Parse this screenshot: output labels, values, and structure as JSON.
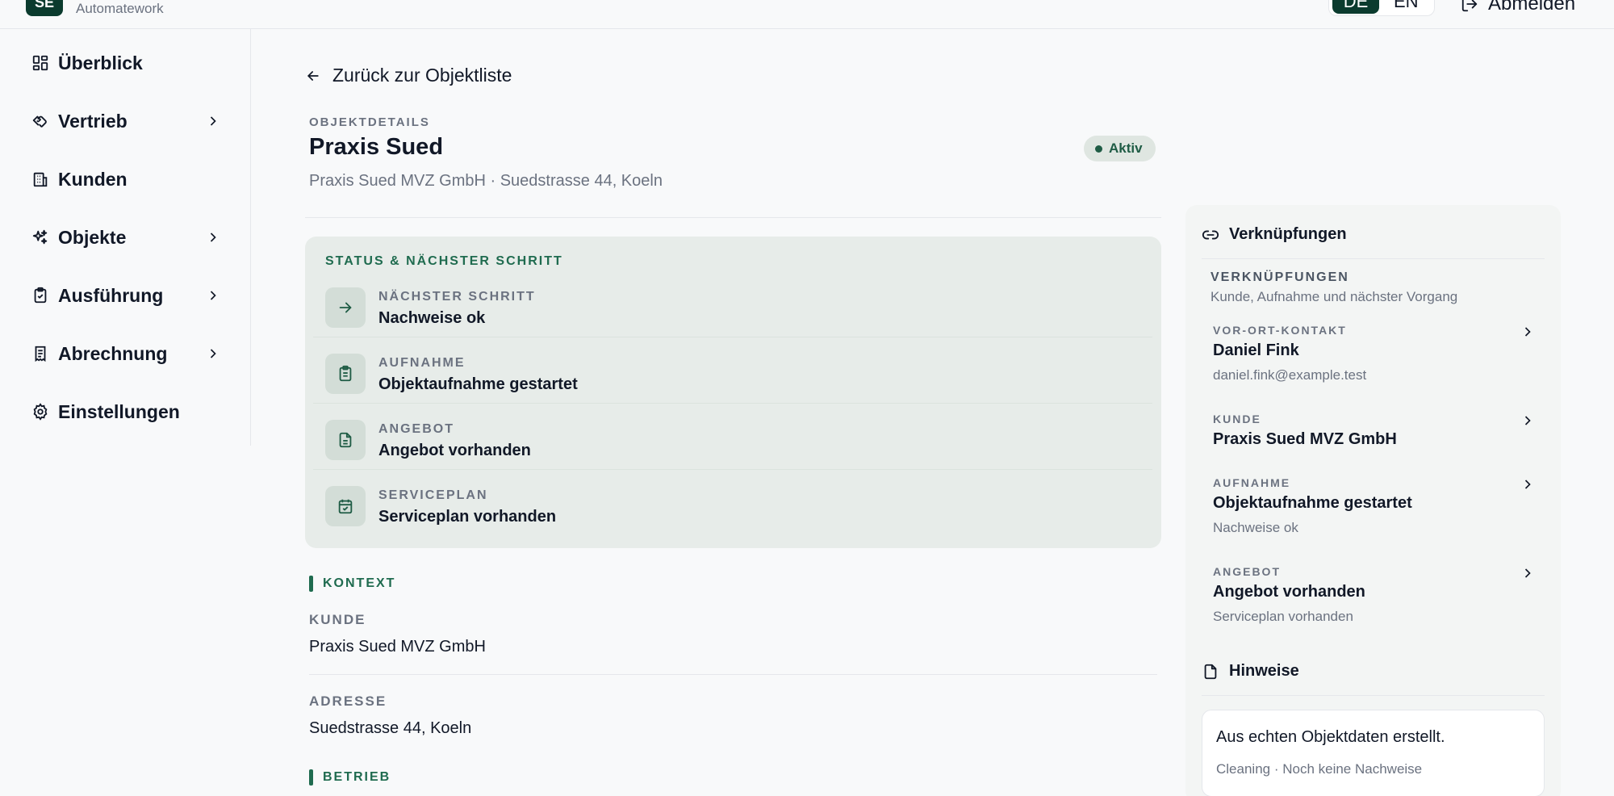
{
  "brand": {
    "logo_text": "SE",
    "subtitle": "Automatework"
  },
  "header": {
    "lang_de": "DE",
    "lang_en": "EN",
    "logout": "Abmelden"
  },
  "sidebar": {
    "items": [
      {
        "label": "Überblick",
        "icon": "dashboard-icon",
        "has_children": false
      },
      {
        "label": "Vertrieb",
        "icon": "handshake-icon",
        "has_children": true
      },
      {
        "label": "Kunden",
        "icon": "building-icon",
        "has_children": false
      },
      {
        "label": "Objekte",
        "icon": "sparkles-icon",
        "has_children": true
      },
      {
        "label": "Ausführung",
        "icon": "clipboard-check-icon",
        "has_children": true
      },
      {
        "label": "Abrechnung",
        "icon": "receipt-icon",
        "has_children": true
      },
      {
        "label": "Einstellungen",
        "icon": "gear-icon",
        "has_children": false
      }
    ]
  },
  "main": {
    "back_link": "Zurück zur Objektliste",
    "eyebrow": "OBJEKTDETAILS",
    "title": "Praxis Sued",
    "subtitle": "Praxis Sued MVZ GmbH · Suedstrasse 44, Koeln",
    "status": "Aktiv",
    "status_panel": {
      "eyebrow": "STATUS & NÄCHSTER SCHRITT",
      "steps": [
        {
          "label": "NÄCHSTER SCHRITT",
          "value": "Nachweise ok",
          "icon": "arrow-right-icon"
        },
        {
          "label": "AUFNAHME",
          "value": "Objektaufnahme gestartet",
          "icon": "clipboard-list-icon"
        },
        {
          "label": "ANGEBOT",
          "value": "Angebot vorhanden",
          "icon": "document-icon"
        },
        {
          "label": "SERVICEPLAN",
          "value": "Serviceplan vorhanden",
          "icon": "calendar-check-icon"
        }
      ]
    },
    "context": {
      "heading": "KONTEXT",
      "fields": [
        {
          "label": "KUNDE",
          "value": "Praxis Sued MVZ GmbH"
        },
        {
          "label": "ADRESSE",
          "value": "Suedstrasse 44, Koeln"
        }
      ]
    },
    "operation": {
      "heading": "BETRIEB"
    }
  },
  "right_panel": {
    "links_heading": "Verknüpfungen",
    "links_eyebrow": "VERKNÜPFUNGEN",
    "links_desc": "Kunde, Aufnahme und nächster Vorgang",
    "links": [
      {
        "label": "VOR-ORT-KONTAKT",
        "value": "Daniel Fink",
        "sub": "daniel.fink@example.test"
      },
      {
        "label": "KUNDE",
        "value": "Praxis Sued MVZ GmbH",
        "sub": ""
      },
      {
        "label": "AUFNAHME",
        "value": "Objektaufnahme gestartet",
        "sub": "Nachweise ok"
      },
      {
        "label": "ANGEBOT",
        "value": "Angebot vorhanden",
        "sub": "Serviceplan vorhanden"
      }
    ],
    "notes_heading": "Hinweise",
    "note_text": "Aus echten Objektdaten erstellt.",
    "note_sub": "Cleaning · Noch keine Nachweise"
  },
  "colors": {
    "brand": "#0b3b2e",
    "accent": "#1f6b4f",
    "panel": "#e7ece9"
  }
}
